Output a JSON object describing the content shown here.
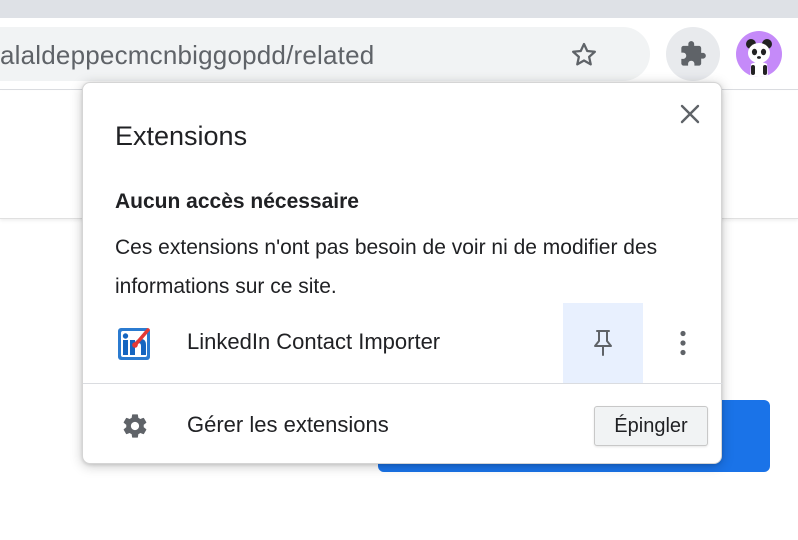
{
  "browser": {
    "url_text": "alaldeppecmcnbiggopdd/related",
    "profile_avatar": "panda-avatar",
    "icons": {
      "bookmark": "star-icon",
      "extensions": "puzzle-icon"
    }
  },
  "popup": {
    "title": "Extensions",
    "section_heading": "Aucun accès nécessaire",
    "section_description": "Ces extensions n'ont pas besoin de voir ni de modifier des informations sur ce site.",
    "extension": {
      "name": "LinkedIn Contact Importer",
      "icon": "linkedin-importer-icon",
      "pin_icon": "pin-icon",
      "more_icon": "more-vert-icon"
    },
    "manage_label": "Gérer les extensions",
    "manage_icon": "gear-icon",
    "close_icon": "close-icon"
  },
  "tooltip": {
    "text": "Épingler"
  },
  "colors": {
    "accent": "#1a73e8",
    "pin_highlight": "#e8f0fe",
    "avatar_bg": "#c58af9",
    "toolbar_bg": "#dee1e6",
    "omnibox_bg": "#f1f3f4"
  }
}
